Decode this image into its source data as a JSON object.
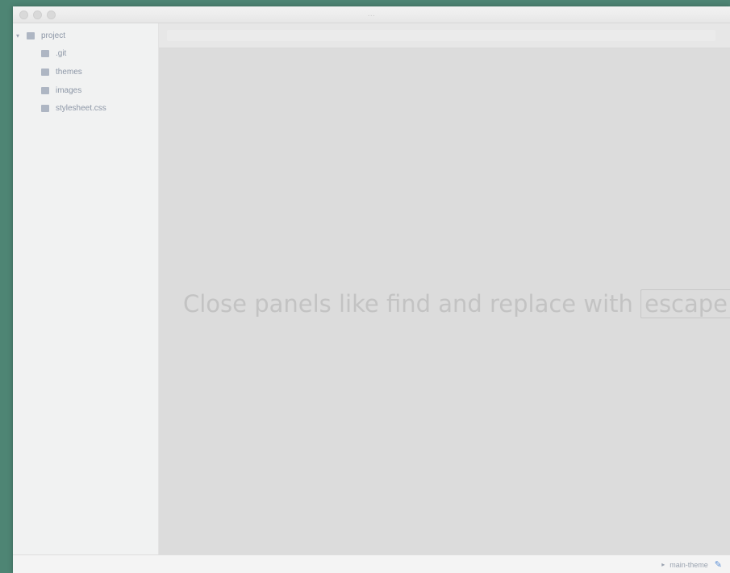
{
  "window": {
    "title": "…"
  },
  "sidebar": {
    "root": {
      "label": "project",
      "icon": "folder-icon"
    },
    "items": [
      {
        "label": ".git",
        "icon": "folder-icon"
      },
      {
        "label": "themes",
        "icon": "folder-icon"
      },
      {
        "label": "images",
        "icon": "folder-icon"
      },
      {
        "label": "stylesheet.css",
        "icon": "file-icon"
      }
    ]
  },
  "main": {
    "caption_prefix": "Close panels like find and replace with",
    "caption_keyword": "escape"
  },
  "status": {
    "right_label": "main-theme"
  },
  "colors": {
    "desktop": "#4e8574",
    "accent": "#5a8fd6"
  }
}
